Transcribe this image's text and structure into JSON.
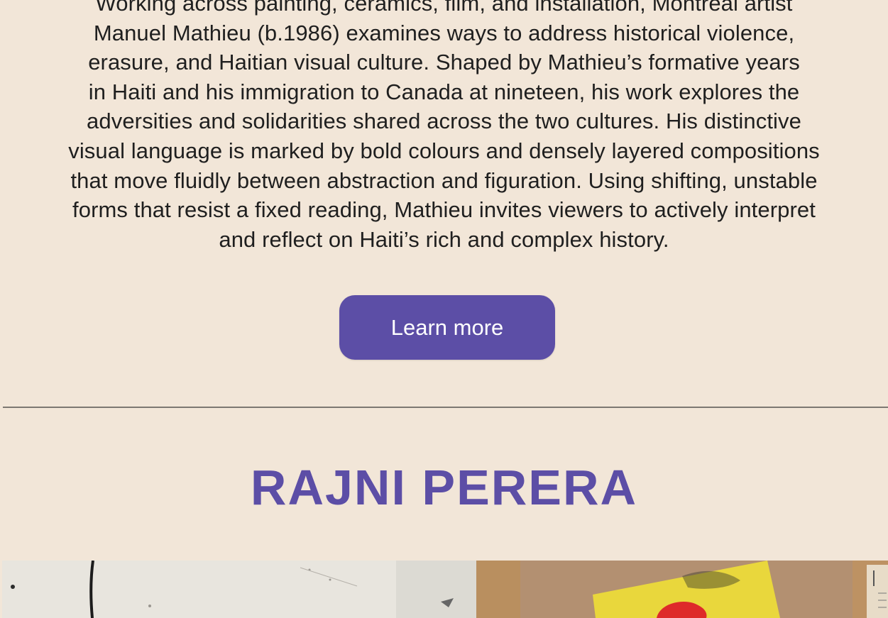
{
  "bio": {
    "lines": [
      "Working across painting, ceramics, film, and installation, Montreal artist",
      "Manuel Mathieu (b.1986) examines ways to address historical violence,",
      "erasure, and Haitian visual culture. Shaped by Mathieu’s formative years",
      "in Haiti and his immigration to Canada at nineteen, his work explores the",
      "adversities and solidarities shared across the two cultures. His distinctive",
      "visual language is marked by bold colours and densely layered compositions",
      "that move fluidly between abstraction and figuration. Using shifting, unstable",
      "forms that resist a fixed reading, Mathieu invites viewers to actively interpret",
      "and reflect on Haiti’s rich and complex history."
    ]
  },
  "learn_more": {
    "label": "Learn more"
  },
  "next_artist": {
    "name": "RAJNI PERERA"
  },
  "colors": {
    "background": "#f2e6d8",
    "accent": "#5c4ea6",
    "text": "#1f1f1f",
    "divider": "#7d7872"
  }
}
